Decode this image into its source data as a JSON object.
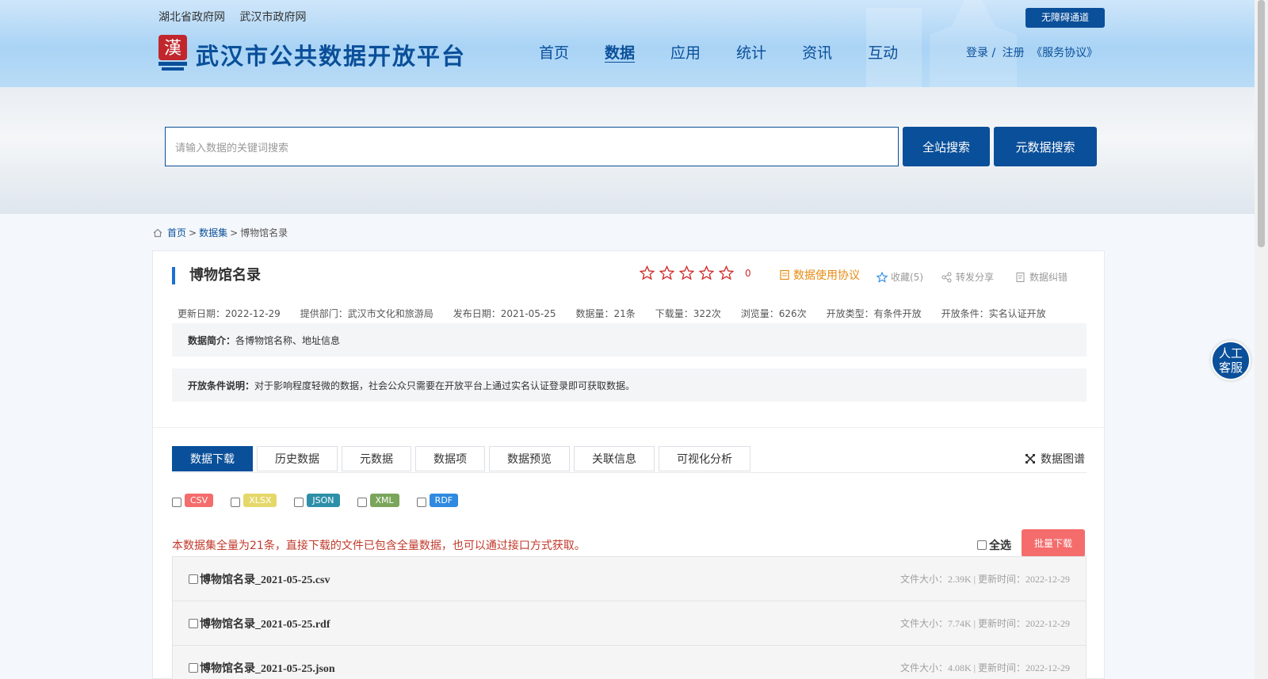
{
  "header": {
    "top_links": [
      "湖北省政府网",
      "武汉市政府网"
    ],
    "accessibility_button": "无障碍通道",
    "site_title": "武汉市公共数据开放平台",
    "nav": [
      "首页",
      "数据",
      "应用",
      "统计",
      "资讯",
      "互动"
    ],
    "active_nav": "数据",
    "login": "登录 /",
    "register": "注册",
    "service_agreement": "《服务协议》"
  },
  "search": {
    "placeholder": "请输入数据的关键词搜索",
    "site_search_button": "全站搜索",
    "metadata_search_button": "元数据搜索"
  },
  "breadcrumb": {
    "home": "首页",
    "sep1": ">",
    "datasets": "数据集",
    "sep2": ">",
    "current": "博物馆名录"
  },
  "dataset": {
    "title": "博物馆名录",
    "rating_count": "0",
    "actions": {
      "agreement": "数据使用协议",
      "favorite": "收藏(5)",
      "share": "转发分享",
      "report": "数据纠错"
    },
    "meta": [
      "更新日期：2022-12-29",
      "提供部门：武汉市文化和旅游局",
      "发布日期：2021-05-25",
      "数据量：21条",
      "下载量：322次",
      "浏览量：626次",
      "开放类型：有条件开放",
      "开放条件：实名认证开放"
    ],
    "summary_label": "数据简介：",
    "summary": "各博物馆名称、地址信息",
    "condition_label": "开放条件说明：",
    "condition": "对于影响程度轻微的数据，社会公众只需要在开放平台上通过实名认证登录即可获取数据。"
  },
  "tabs": [
    "数据下载",
    "历史数据",
    "元数据",
    "数据项",
    "数据预览",
    "关联信息",
    "可视化分析"
  ],
  "graph_link": "数据图谱",
  "formats": [
    {
      "label": "CSV",
      "color": "#f56c6c"
    },
    {
      "label": "XLSX",
      "color": "#e5d86a"
    },
    {
      "label": "JSON",
      "color": "#2d8fa8"
    },
    {
      "label": "XML",
      "color": "#7aa55a"
    },
    {
      "label": "RDF",
      "color": "#2f8ae0"
    }
  ],
  "notice": "本数据集全量为21条，直接下载的文件已包含全量数据，也可以通过接口方式获取。",
  "select_all": "全选",
  "batch_download": "批量下载",
  "files": [
    {
      "name": "博物馆名录_2021-05-25.csv",
      "info": "文件大小：2.39K | 更新时间：2022-12-29"
    },
    {
      "name": "博物馆名录_2021-05-25.rdf",
      "info": "文件大小：7.74K | 更新时间：2022-12-29"
    },
    {
      "name": "博物馆名录_2021-05-25.json",
      "info": "文件大小：4.08K | 更新时间：2022-12-29"
    }
  ],
  "customer_service": "人工客服",
  "colors": {
    "primary": "#0a4f99",
    "danger": "#f56c6c",
    "agreement": "#e88a12",
    "star": "#d12a2a"
  }
}
